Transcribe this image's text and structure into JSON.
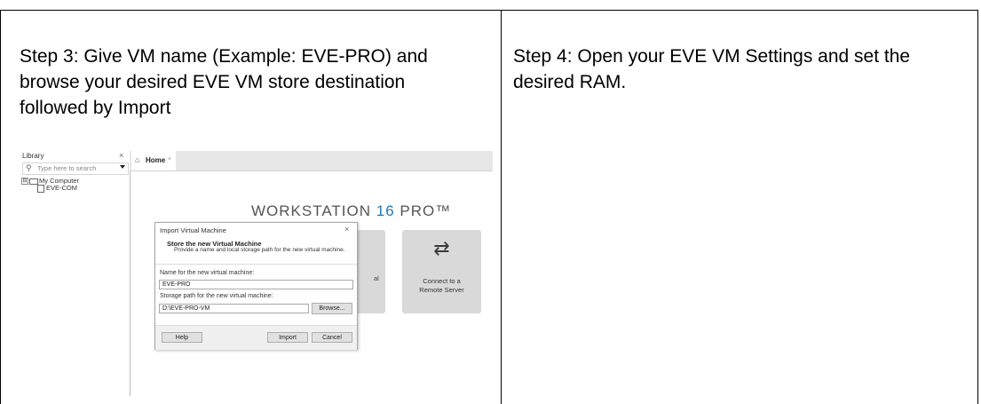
{
  "cells": {
    "step3": "Step 3: Give VM name (Example: EVE-PRO) and browse your desired EVE VM store destination followed by Import",
    "step4": "Step 4: Open your EVE VM Settings and set the desired RAM."
  },
  "screenshot": {
    "library": {
      "title": "Library",
      "close": "×",
      "search_placeholder": "Type here to search",
      "tree": {
        "expander": "⊟",
        "root": "My Computer",
        "child": "EVE-COM"
      }
    },
    "tab": {
      "label": "Home",
      "close": "×"
    },
    "brand": {
      "prefix": "WORKSTATION ",
      "number": "16",
      "suffix": " PRO™"
    },
    "tile_a_label": "al",
    "tile_b": {
      "icon": "⇄",
      "label_line1": "Connect to a",
      "label_line2": "Remote Server"
    },
    "dialog": {
      "title": "Import Virtual Machine",
      "close": "×",
      "heading": "Store the new Virtual Machine",
      "subheading": "Provide a name and local storage path for the new virtual machine.",
      "name_label": "Name for the new virtual machine:",
      "name_value": "EVE-PRO",
      "path_label": "Storage path for the new virtual machine:",
      "path_value": "D:\\EVE-PRO-VM",
      "browse_label": "Browse...",
      "help_label": "Help",
      "import_label": "Import",
      "cancel_label": "Cancel"
    }
  },
  "colors": {
    "brand_accent": "#1f76b8",
    "tile_bg": "#d9d9d9"
  }
}
